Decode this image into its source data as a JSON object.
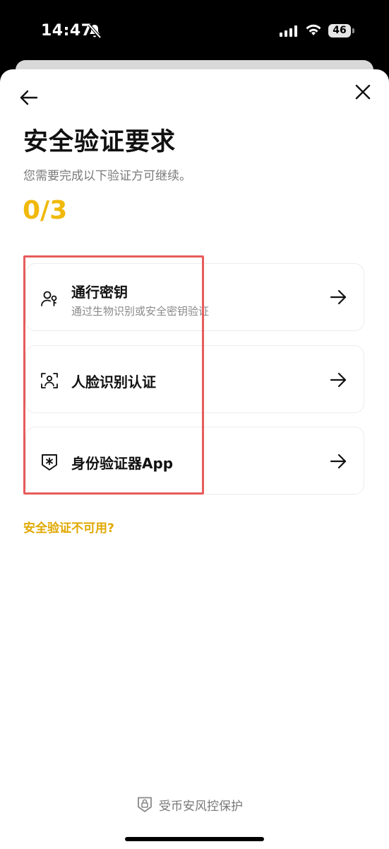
{
  "status_bar": {
    "time": "14:47",
    "battery": "46"
  },
  "header": {
    "back_icon": "arrow-left-icon",
    "close_icon": "close-icon"
  },
  "main": {
    "title": "安全验证要求",
    "subtitle": "您需要完成以下验证方可继续。",
    "progress": "0/3",
    "options": [
      {
        "label": "通行密钥",
        "description": "通过生物识别或安全密钥验证",
        "icon": "passkey-users-icon"
      },
      {
        "label": "人脸识别认证",
        "description": "",
        "icon": "face-scan-icon"
      },
      {
        "label": "身份验证器App",
        "description": "",
        "icon": "authenticator-shield-icon"
      }
    ],
    "unavailable_link": "安全验证不可用?"
  },
  "footer": {
    "text": "受币安风控保护",
    "icon": "shield-lock-icon"
  },
  "colors": {
    "accent": "#f0b90b",
    "highlight_border": "#e85b5b"
  }
}
